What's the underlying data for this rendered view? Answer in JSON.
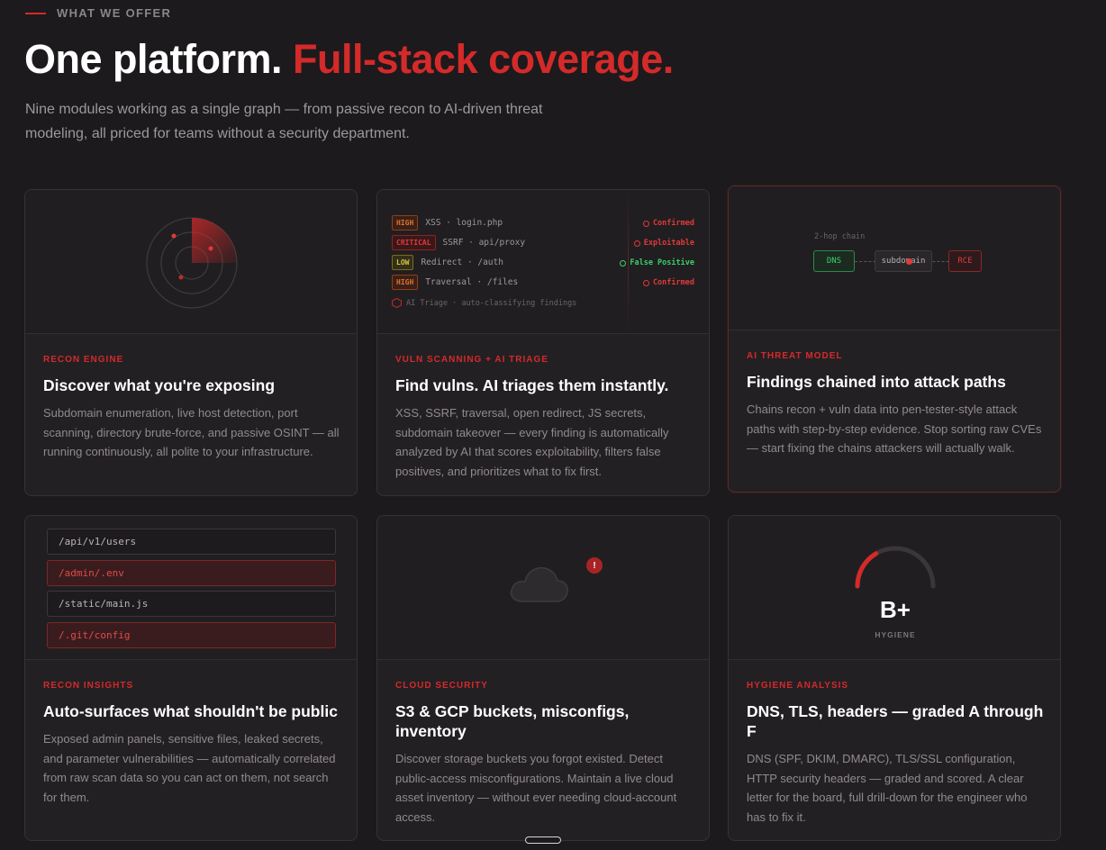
{
  "section": {
    "eyebrow": "WHAT WE OFFER",
    "headline_plain": "One platform.",
    "headline_accent": "Full-stack coverage.",
    "subtitle": "Nine modules working as a single graph — from passive recon to AI-driven threat modeling, all priced for teams without a security department."
  },
  "colors": {
    "accent": "#d42a2a",
    "background": "#1c1a1c",
    "card": "#232023",
    "success": "#3ad06a"
  },
  "cards": [
    {
      "tag": "RECON ENGINE",
      "title": "Discover what you're exposing",
      "desc": "Subdomain enumeration, live host detection, port scanning, directory brute-force, and passive OSINT — all running continuously, all polite to your infrastructure.",
      "icon": "radar-icon"
    },
    {
      "tag": "VULN SCANNING + AI TRIAGE",
      "title": "Find vulns. AI triages them instantly.",
      "desc": "XSS, SSRF, traversal, open redirect, JS secrets, subdomain takeover — every finding is automatically analyzed by AI that scores exploitability, filters false positives, and prioritizes what to fix first.",
      "findings": [
        {
          "severity": "HIGH",
          "text": "XSS · login.php",
          "result": "Confirmed"
        },
        {
          "severity": "CRITICAL",
          "text": "SSRF · api/proxy",
          "result": "Exploitable"
        },
        {
          "severity": "LOW",
          "text": "Redirect · /auth",
          "result": "False Positive"
        },
        {
          "severity": "HIGH",
          "text": "Traversal · /files",
          "result": "Confirmed"
        }
      ],
      "footer": "AI Triage · auto-classifying findings"
    },
    {
      "tag": "AI THREAT MODEL",
      "title": "Findings chained into attack paths",
      "desc": "Chains recon + vuln data into pen-tester-style attack paths with step-by-step evidence. Stop sorting raw CVEs — start fixing the chains attackers will actually walk.",
      "chain_label": "2-hop chain",
      "nodes": [
        "DNS",
        "subdomain",
        "RCE"
      ]
    },
    {
      "tag": "RECON INSIGHTS",
      "title": "Auto-surfaces what shouldn't be public",
      "desc": "Exposed admin panels, sensitive files, leaked secrets, and parameter vulnerabilities — automatically correlated from raw scan data so you can act on them, not search for them.",
      "paths": [
        "/api/v1/users",
        "/admin/.env",
        "/static/main.js",
        "/.git/config"
      ]
    },
    {
      "tag": "CLOUD SECURITY",
      "title": "S3 & GCP buckets, misconfigs, inventory",
      "desc": "Discover storage buckets you forgot existed. Detect public-access misconfigurations. Maintain a live cloud asset inventory — without ever needing cloud-account access.",
      "alert": "!",
      "icon": "cloud-icon"
    },
    {
      "tag": "HYGIENE ANALYSIS",
      "title": "DNS, TLS, headers — graded A through F",
      "desc": "DNS (SPF, DKIM, DMARC), TLS/SSL configuration, HTTP security headers — graded and scored. A clear letter for the board, full drill-down for the engineer who has to fix it.",
      "grade": "B+",
      "grade_label": "HYGIENE",
      "gauge_fraction": 0.33
    }
  ]
}
